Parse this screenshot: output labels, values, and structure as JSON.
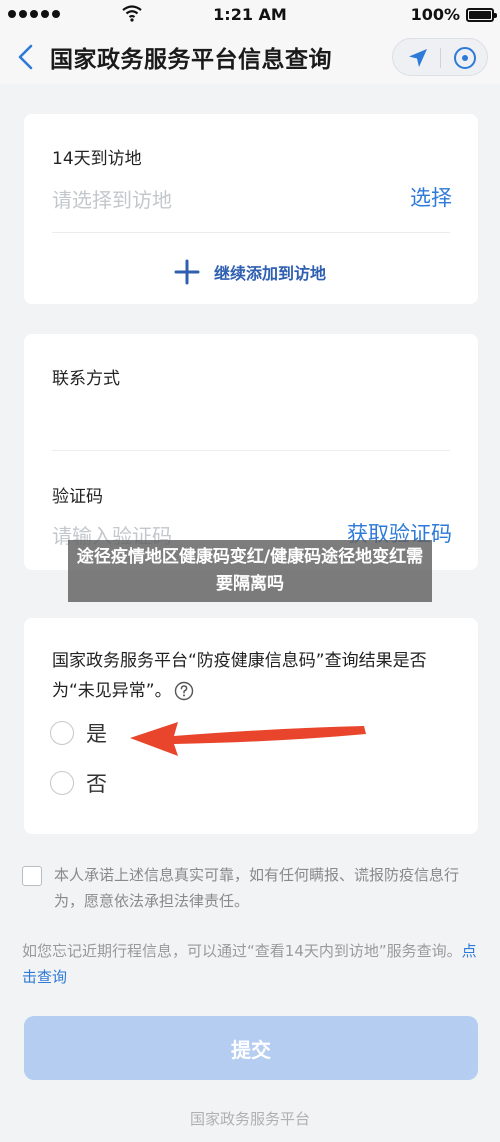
{
  "status_bar": {
    "time": "1:21 AM",
    "battery": "100%"
  },
  "nav": {
    "title": "国家政务服务平台信息查询"
  },
  "visit_card": {
    "label": "14天到访地",
    "placeholder": "请选择到访地",
    "select_label": "选择",
    "add_label": "继续添加到访地"
  },
  "contact_card": {
    "contact_label": "联系方式",
    "code_label": "验证码",
    "code_placeholder": "请输入验证码",
    "get_code_label": "获取验证码"
  },
  "question_card": {
    "question": "国家政务服务平台“防疫健康信息码”查询结果是否为“未见异常”。",
    "options": [
      "是",
      "否"
    ]
  },
  "promise_text": "本人承诺上述信息真实可靠，如有任何瞒报、谎报防疫信息行为，愿意依法承担法律责任。",
  "hint": {
    "text": "如您忘记近期行程信息，可以通过“查看14天内到访地”服务查询。",
    "link": "点击查询"
  },
  "submit_label": "提交",
  "footer": "国家政务服务平台",
  "overlay_caption": "途径疫情地区健康码变红/健康码途径地变红需要隔离吗",
  "colors": {
    "accent_blue": "#2e7ad8",
    "submit_bg": "#b5cdf0",
    "arrow_red": "#e8452c"
  }
}
